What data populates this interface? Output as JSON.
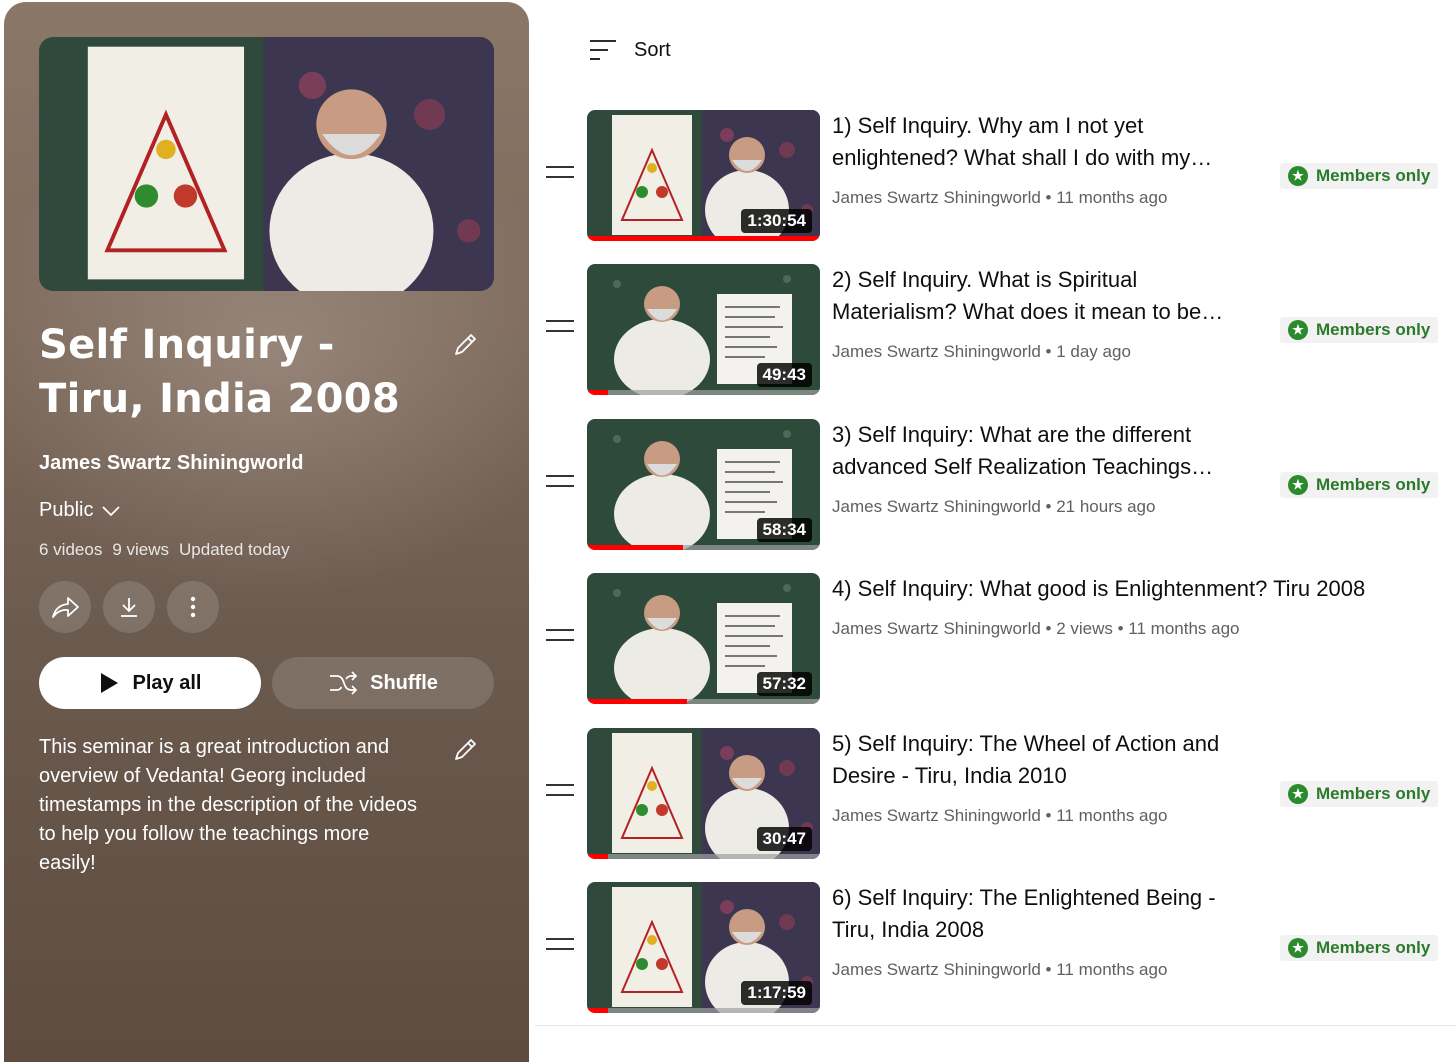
{
  "playlist": {
    "title": "Self Inquiry - Tiru, India 2008",
    "owner": "James Swartz Shiningworld",
    "privacy": "Public",
    "stats": {
      "videos": "6 videos",
      "views": "9 views",
      "updated": "Updated today"
    },
    "play_all_label": "Play all",
    "shuffle_label": "Shuffle",
    "description": "This seminar is a great introduction and overview of Vedanta! Georg included timestamps in the description of the videos to help you follow the teachings more easily!",
    "icons": [
      "pencil-icon",
      "chevron-down-icon",
      "share-icon",
      "download-icon",
      "more-icon",
      "play-icon",
      "shuffle-icon"
    ]
  },
  "sort": {
    "label": "Sort",
    "icon": "sort-icon"
  },
  "badge_label": "Members only",
  "colors": {
    "accent_red": "#ff0000",
    "members_green": "#2b7a2b",
    "panel_brown": "#6b5a4e"
  },
  "videos": [
    {
      "title": "1) Self Inquiry. Why am I not yet enlightened? What shall I do with my…",
      "channel": "James Swartz Shiningworld",
      "meta": "11 months ago",
      "duration": "1:30:54",
      "progress": 1.0,
      "members_only": true
    },
    {
      "title": "2) Self Inquiry. What is Spiritual Materialism? What does it mean to be…",
      "channel": "James Swartz Shiningworld",
      "meta": "1 day ago",
      "duration": "49:43",
      "progress": 0.09,
      "members_only": true
    },
    {
      "title": "3) Self Inquiry: What are the different advanced Self Realization Teachings…",
      "channel": "James Swartz Shiningworld",
      "meta": "21 hours ago",
      "duration": "58:34",
      "progress": 0.41,
      "members_only": true
    },
    {
      "title": "4) Self Inquiry: What good is Enlightenment? Tiru 2008",
      "channel": "James Swartz Shiningworld",
      "meta": "2 views • 11 months ago",
      "duration": "57:32",
      "progress": 0.43,
      "members_only": false
    },
    {
      "title": "5) Self Inquiry: The Wheel of Action and Desire - Tiru, India 2010",
      "channel": "James Swartz Shiningworld",
      "meta": "11 months ago",
      "duration": "30:47",
      "progress": 0.09,
      "members_only": true
    },
    {
      "title": "6) Self Inquiry: The Enlightened Being - Tiru, India 2008",
      "channel": "James Swartz Shiningworld",
      "meta": "11 months ago",
      "duration": "1:17:59",
      "progress": 0.09,
      "members_only": true
    }
  ]
}
